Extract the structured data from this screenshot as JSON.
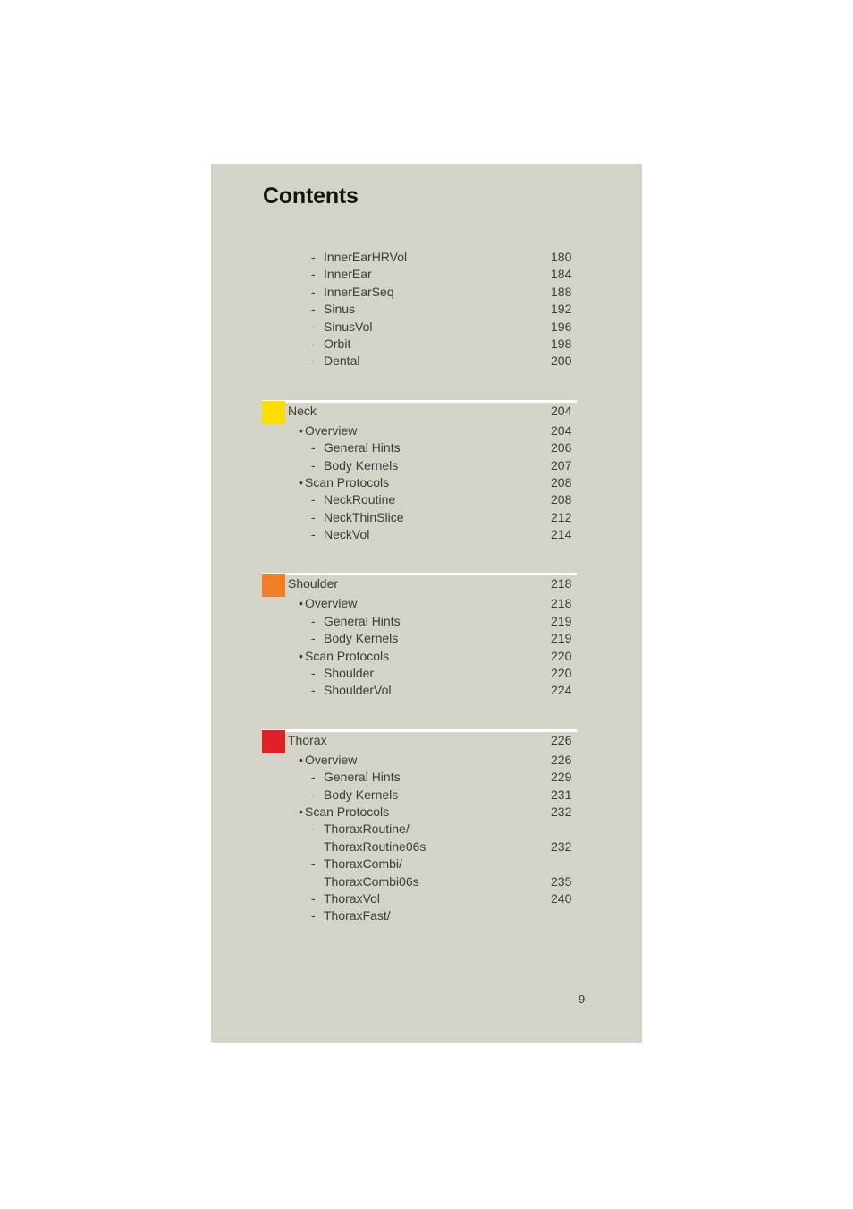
{
  "document": {
    "title": "Contents",
    "page_number": "9",
    "sheet_background": "#d3d3c8",
    "rule_color": "#ffffff",
    "text_color": "#3b3b38"
  },
  "toc": {
    "groups": [
      {
        "name": "continued-entries",
        "has_rule": false,
        "swatch_color": null,
        "header": null,
        "rows": [
          {
            "level": "dash",
            "label": "InnerEarHRVol",
            "page": "180"
          },
          {
            "level": "dash",
            "label": "InnerEar",
            "page": "184"
          },
          {
            "level": "dash",
            "label": "InnerEarSeq",
            "page": "188"
          },
          {
            "level": "dash",
            "label": "Sinus",
            "page": "192"
          },
          {
            "level": "dash",
            "label": "SinusVol",
            "page": "196"
          },
          {
            "level": "dash",
            "label": "Orbit",
            "page": "198"
          },
          {
            "level": "dash",
            "label": "Dental",
            "page": "200"
          }
        ]
      },
      {
        "name": "neck",
        "has_rule": true,
        "swatch_color": "#fbdd00",
        "header": {
          "label": "Neck",
          "page": "204"
        },
        "rows": [
          {
            "level": "bullet",
            "label": "Overview",
            "page": "204"
          },
          {
            "level": "dash",
            "label": "General Hints",
            "page": "206"
          },
          {
            "level": "dash",
            "label": "Body Kernels",
            "page": "207"
          },
          {
            "level": "bullet",
            "label": "Scan Protocols",
            "page": "208"
          },
          {
            "level": "dash",
            "label": "NeckRoutine",
            "page": "208"
          },
          {
            "level": "dash",
            "label": "NeckThinSlice",
            "page": "212"
          },
          {
            "level": "dash",
            "label": "NeckVol",
            "page": "214"
          }
        ]
      },
      {
        "name": "shoulder",
        "has_rule": true,
        "swatch_color": "#ef7f22",
        "header": {
          "label": "Shoulder",
          "page": "218"
        },
        "rows": [
          {
            "level": "bullet",
            "label": "Overview",
            "page": "218"
          },
          {
            "level": "dash",
            "label": "General Hints",
            "page": "219"
          },
          {
            "level": "dash",
            "label": "Body Kernels",
            "page": "219"
          },
          {
            "level": "bullet",
            "label": "Scan Protocols",
            "page": "220"
          },
          {
            "level": "dash",
            "label": "Shoulder",
            "page": "220"
          },
          {
            "level": "dash",
            "label": "ShoulderVol",
            "page": "224"
          }
        ]
      },
      {
        "name": "thorax",
        "has_rule": true,
        "swatch_color": "#e11f26",
        "header": {
          "label": "Thorax",
          "page": "226"
        },
        "rows": [
          {
            "level": "bullet",
            "label": "Overview",
            "page": "226"
          },
          {
            "level": "dash",
            "label": "General Hints",
            "page": "229"
          },
          {
            "level": "dash",
            "label": "Body Kernels",
            "page": "231"
          },
          {
            "level": "bullet",
            "label": "Scan Protocols",
            "page": "232"
          },
          {
            "level": "dash",
            "label": "ThoraxRoutine/",
            "page": ""
          },
          {
            "level": "cont",
            "label": "ThoraxRoutine06s",
            "page": "232"
          },
          {
            "level": "dash",
            "label": "ThoraxCombi/",
            "page": ""
          },
          {
            "level": "cont",
            "label": "ThoraxCombi06s",
            "page": "235"
          },
          {
            "level": "dash",
            "label": "ThoraxVol",
            "page": "240"
          },
          {
            "level": "dash",
            "label": "ThoraxFast/",
            "page": ""
          }
        ]
      }
    ]
  },
  "marks": {
    "bullet": "•",
    "dash": "-"
  }
}
